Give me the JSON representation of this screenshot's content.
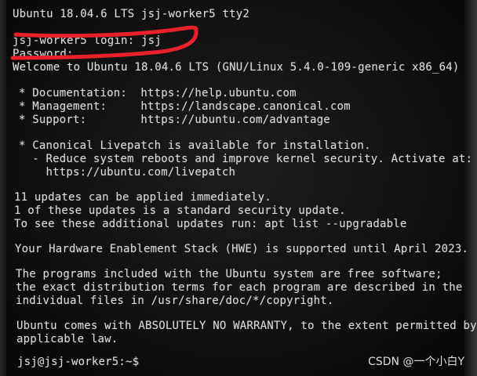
{
  "console": {
    "header": "Ubuntu 18.04.6 LTS jsj-worker5 tty2",
    "login_prompt": "jsj-worker5 login: jsj",
    "password_prompt": "Password:",
    "welcome": "Welcome to Ubuntu 18.04.6 LTS (GNU/Linux 5.4.0-109-generic x86_64)",
    "documentation": "* Documentation:  https://help.ubuntu.com",
    "management": "* Management:     https://landscape.canonical.com",
    "support": "* Support:        https://ubuntu.com/advantage",
    "livepatch_line1": "* Canonical Livepatch is available for installation.",
    "livepatch_line2": "  - Reduce system reboots and improve kernel security. Activate at:",
    "livepatch_line3": "    https://ubuntu.com/livepatch",
    "updates_line1": "11 updates can be applied immediately.",
    "updates_line2": "1 of these updates is a standard security update.",
    "updates_line3": "To see these additional updates run: apt list --upgradable",
    "hwe": "Your Hardware Enablement Stack (HWE) is supported until April 2023.",
    "programs_line1": "The programs included with the Ubuntu system are free software;",
    "programs_line2": "the exact distribution terms for each program are described in the",
    "programs_line3": "individual files in /usr/share/doc/*/copyright.",
    "warranty_line1": "Ubuntu comes with ABSOLUTELY NO WARRANTY, to the extent permitted by",
    "warranty_line2": "applicable law.",
    "shell_prompt": "jsj@jsj-worker5:~$"
  },
  "watermark": "CSDN @一个小白Y",
  "colors": {
    "terminal_text": "#d8d8d8",
    "annotation": "#e8202a"
  }
}
